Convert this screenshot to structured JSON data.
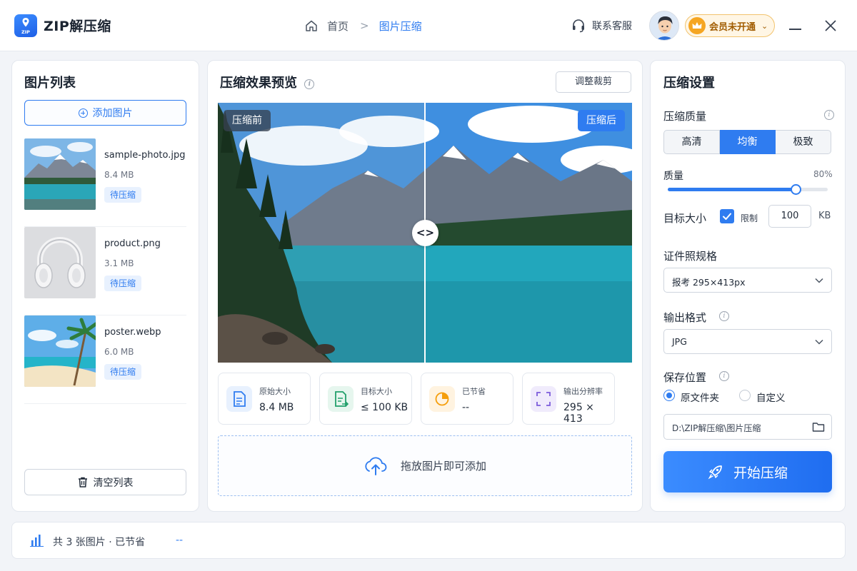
{
  "app": {
    "title": "ZIP解压缩",
    "logo_text": "ZIP"
  },
  "breadcrumb": {
    "home": "首页",
    "separator": ">",
    "current": "图片压缩"
  },
  "header": {
    "support": "联系客服",
    "vip": "会员未开通"
  },
  "image_list": {
    "title": "图片列表",
    "add_label": "添加图片",
    "clear_label": "清空列表",
    "items": [
      {
        "name": "sample-photo.jpg",
        "size": "8.4 MB",
        "status": "待压缩",
        "thumb": "lake-icon"
      },
      {
        "name": "product.png",
        "size": "3.1 MB",
        "status": "待压缩",
        "thumb": "headphones-icon"
      },
      {
        "name": "poster.webp",
        "size": "6.0 MB",
        "status": "待压缩",
        "thumb": "beach-icon"
      }
    ]
  },
  "preview": {
    "title": "压缩效果预览",
    "crop_label": "调整裁剪",
    "before_label": "压缩前",
    "after_label": "压缩后",
    "knob": "<>",
    "stats": [
      {
        "label": "原始大小",
        "value": "8.4 MB",
        "icon": "file-icon",
        "color": "#2f7cf0",
        "bg": "#e8f1fe"
      },
      {
        "label": "目标大小",
        "value": "≤ 100 KB",
        "icon": "file-arrow-icon",
        "color": "#22a06b",
        "bg": "#e6f6ee"
      },
      {
        "label": "已节省",
        "value": "--",
        "icon": "pie-icon",
        "color": "#f59e0b",
        "bg": "#fff3e0"
      },
      {
        "label": "输出分辨率",
        "value": "295 × 413",
        "icon": "resize-icon",
        "color": "#7c5cdb",
        "bg": "#f0ebfc"
      }
    ],
    "drop_label": "拖放图片即可添加"
  },
  "settings": {
    "title": "压缩设置",
    "quality_label": "压缩质量",
    "quality_options": [
      "高清",
      "均衡",
      "极致"
    ],
    "quality_selected": 1,
    "q_label": "质量",
    "q_value_text": "80%",
    "q_value": 0.8,
    "target_label": "目标大小",
    "limit_label": "限制",
    "limit_checked": true,
    "target_value": "100",
    "target_unit": "KB",
    "spec_label": "证件照规格",
    "spec_value": "报考  295×413px",
    "format_label": "输出格式",
    "format_value": "JPG",
    "save_label": "保存位置",
    "save_options": [
      "原文件夹",
      "自定义"
    ],
    "save_selected": 0,
    "save_path": "D:\\ZIP解压缩\\图片压缩",
    "start_label": "开始压缩"
  },
  "footer": {
    "summary": "共 3 张图片 · 已节省",
    "saved": "--"
  },
  "colors": {
    "accent": "#2f7cf0",
    "vip": "#f5a623"
  }
}
